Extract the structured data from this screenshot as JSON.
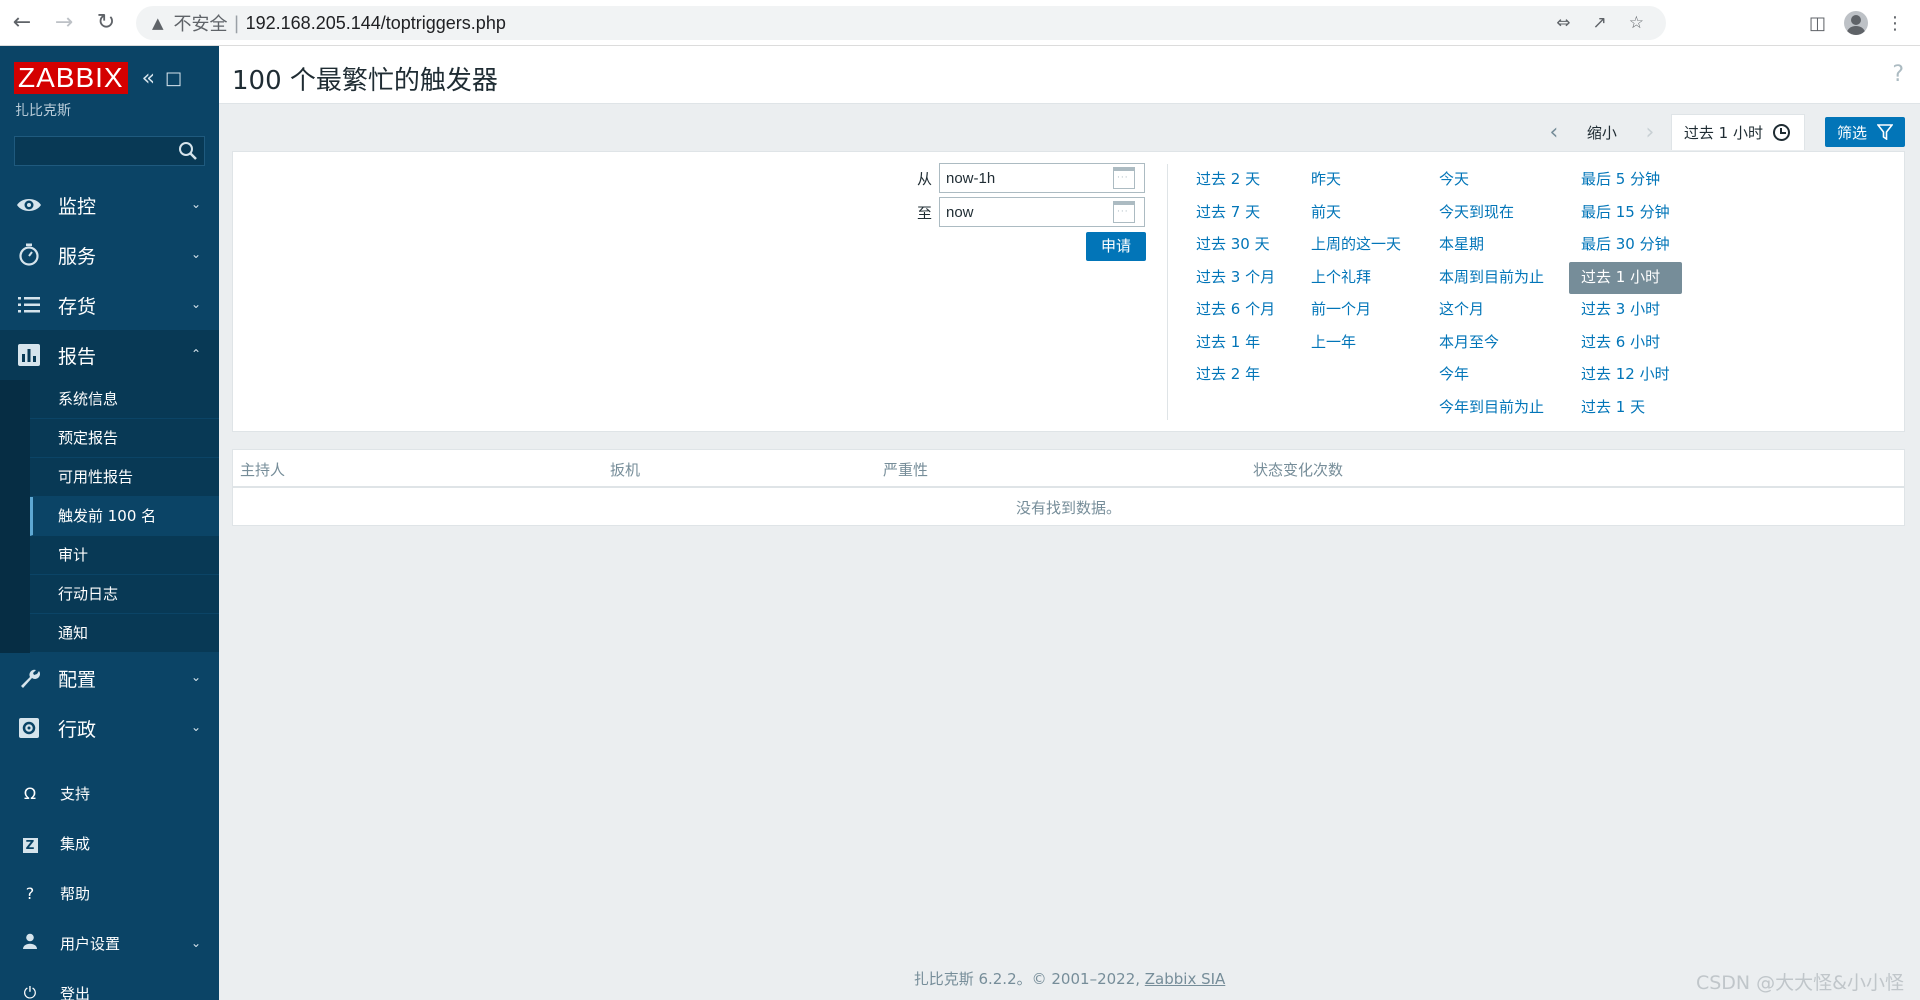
{
  "browser": {
    "insecure_label": "不安全",
    "url": "192.168.205.144/toptriggers.php"
  },
  "sidebar": {
    "logo": "ZABBIX",
    "server_name": "扎比克斯",
    "menu": [
      {
        "label": "监控",
        "icon": "eye-icon"
      },
      {
        "label": "服务",
        "icon": "stopwatch-icon"
      },
      {
        "label": "存货",
        "icon": "list-icon"
      },
      {
        "label": "报告",
        "icon": "bar-chart-icon"
      }
    ],
    "reports_submenu": [
      "系统信息",
      "预定报告",
      "可用性报告",
      "触发前 100 名",
      "审计",
      "行动日志",
      "通知"
    ],
    "menu2": [
      {
        "label": "配置",
        "icon": "wrench-icon"
      },
      {
        "label": "行政",
        "icon": "gear-icon"
      }
    ],
    "bottom": [
      {
        "label": "支持",
        "icon": "headset-icon"
      },
      {
        "label": "集成",
        "icon": "zabbix-z-icon"
      },
      {
        "label": "帮助",
        "icon": "question-icon"
      },
      {
        "label": "用户设置",
        "icon": "user-icon"
      },
      {
        "label": "登出",
        "icon": "power-icon"
      }
    ]
  },
  "header": {
    "title": "100 个最繁忙的触发器",
    "help": "?"
  },
  "timebar": {
    "zoom_out": "缩小",
    "range_tab": "过去 1 小时",
    "filter": "筛选"
  },
  "filter": {
    "from_label": "从",
    "from_value": "now-1h",
    "to_label": "至",
    "to_value": "now",
    "apply": "申请",
    "quick_ranges": [
      [
        "过去 2 天",
        "过去 7 天",
        "过去 30 天",
        "过去 3 个月",
        "过去 6 个月",
        "过去 1 年",
        "过去 2 年"
      ],
      [
        "昨天",
        "前天",
        "上周的这一天",
        "上个礼拜",
        "前一个月",
        "上一年"
      ],
      [
        "今天",
        "今天到现在",
        "本星期",
        "本周到目前为止",
        "这个月",
        "本月至今",
        "今年",
        "今年到目前为止"
      ],
      [
        "最后 5 分钟",
        "最后 15 分钟",
        "最后 30 分钟",
        "过去 1 小时",
        "过去 3 小时",
        "过去 6 小时",
        "过去 12 小时",
        "过去 1 天"
      ]
    ],
    "selected": "过去 1 小时"
  },
  "table": {
    "columns": [
      "主持人",
      "扳机",
      "严重性",
      "状态变化次数"
    ],
    "empty": "没有找到数据。"
  },
  "footer": {
    "text": "扎比克斯 6.2.2。© 2001–2022, ",
    "link": "Zabbix SIA"
  },
  "watermark": "CSDN @大大怪&小小怪",
  "colors": {
    "sidebar_bg": "#0b4466",
    "accent_blue": "#0275b8",
    "logo_red": "#d40000"
  }
}
